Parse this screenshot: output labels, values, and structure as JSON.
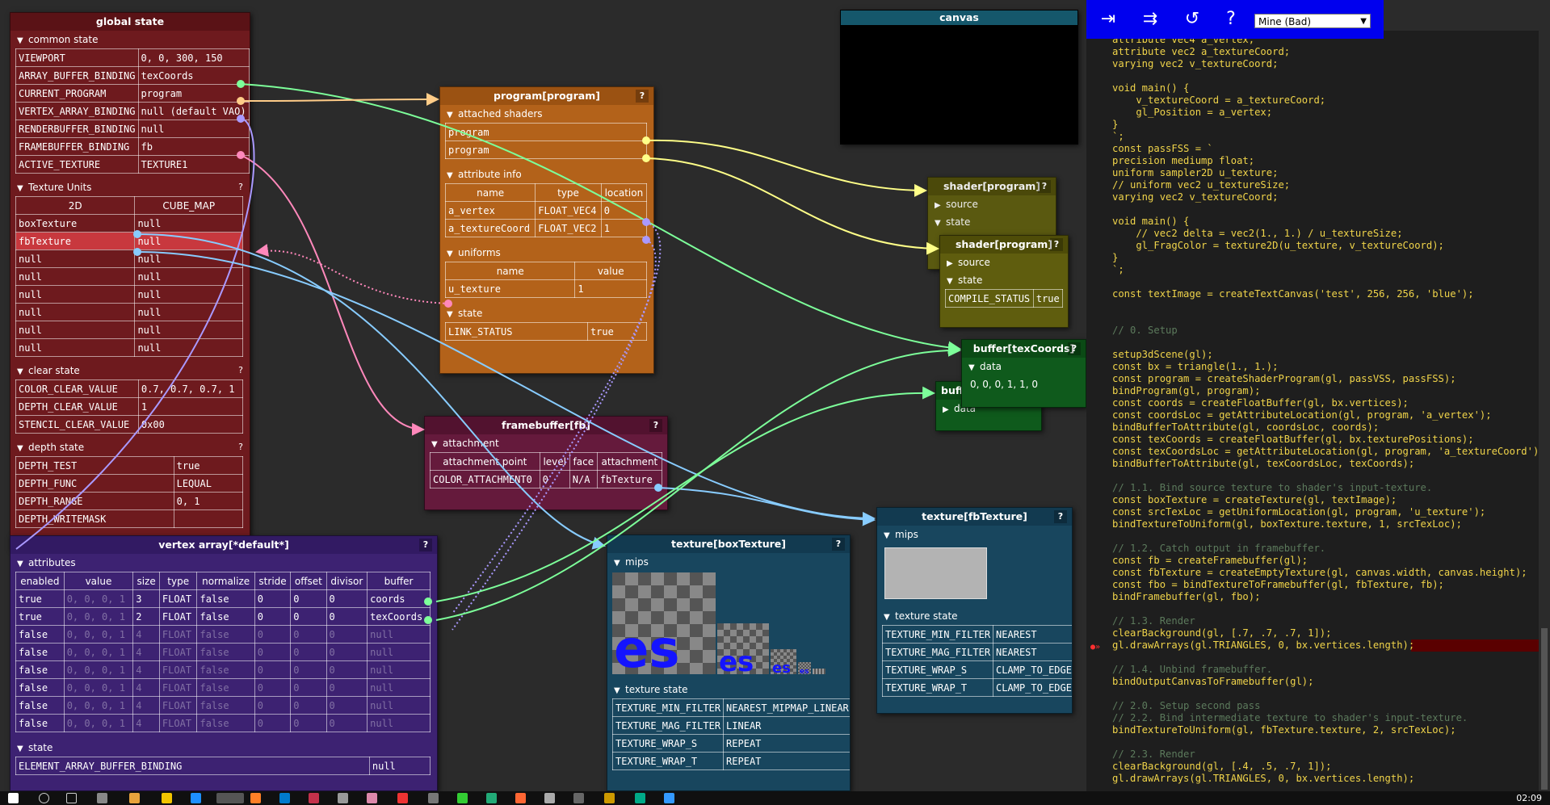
{
  "toolbar": {
    "buttons": [
      "⇥",
      "⇉",
      "↺",
      "?"
    ],
    "example_select": "Mine (Bad)"
  },
  "global_state": {
    "title": "global state",
    "common_state_label": "common state",
    "common_rows": [
      [
        "VIEWPORT",
        "0, 0, 300, 150"
      ],
      [
        "ARRAY_BUFFER_BINDING",
        "texCoords"
      ],
      [
        "CURRENT_PROGRAM",
        "program"
      ],
      [
        "VERTEX_ARRAY_BINDING",
        "null (default VAO)"
      ],
      [
        "RENDERBUFFER_BINDING",
        "null"
      ],
      [
        "FRAMEBUFFER_BINDING",
        "fb"
      ],
      [
        "ACTIVE_TEXTURE",
        "TEXTURE1"
      ]
    ],
    "texture_units_label": "Texture Units",
    "texture_units_header": [
      "2D",
      "CUBE_MAP"
    ],
    "texture_units_rows": [
      [
        "boxTexture",
        "null"
      ],
      [
        "fbTexture",
        "null"
      ],
      [
        "null",
        "null"
      ],
      [
        "null",
        "null"
      ],
      [
        "null",
        "null"
      ],
      [
        "null",
        "null"
      ],
      [
        "null",
        "null"
      ],
      [
        "null",
        "null"
      ]
    ],
    "clear_state_label": "clear state",
    "clear_rows": [
      [
        "COLOR_CLEAR_VALUE",
        "0.7, 0.7, 0.7, 1"
      ],
      [
        "DEPTH_CLEAR_VALUE",
        "1"
      ],
      [
        "STENCIL_CLEAR_VALUE",
        "0x00"
      ]
    ],
    "depth_state_label": "depth state",
    "depth_rows": [
      [
        "DEPTH_TEST",
        "true"
      ],
      [
        "DEPTH_FUNC",
        "LEQUAL"
      ],
      [
        "DEPTH_RANGE",
        "0, 1"
      ],
      [
        "DEPTH_WRITEMASK",
        ""
      ]
    ],
    "q": "?"
  },
  "program": {
    "title": "program[program]",
    "attached_shaders_label": "attached shaders",
    "shaders": [
      "program",
      "program"
    ],
    "attribute_info_label": "attribute info",
    "attr_header": [
      "name",
      "type",
      "location"
    ],
    "attr_rows": [
      [
        "a_vertex",
        "FLOAT_VEC4",
        "0"
      ],
      [
        "a_textureCoord",
        "FLOAT_VEC2",
        "1"
      ]
    ],
    "uniforms_label": "uniforms",
    "uni_header": [
      "name",
      "value"
    ],
    "uni_rows": [
      [
        "u_texture",
        "1"
      ]
    ],
    "state_label": "state",
    "state_rows": [
      [
        "LINK_STATUS",
        "true"
      ]
    ],
    "q": "?"
  },
  "framebuffer": {
    "title": "framebuffer[fb]",
    "attachment_label": "attachment",
    "header": [
      "attachment point",
      "level",
      "face",
      "attachment"
    ],
    "rows": [
      [
        "COLOR_ATTACHMENT0",
        "0",
        "N/A",
        "fbTexture"
      ]
    ],
    "q": "?"
  },
  "vertex_array": {
    "title": "vertex array[*default*]",
    "attributes_label": "attributes",
    "header": [
      "enabled",
      "value",
      "size",
      "type",
      "normalize",
      "stride",
      "offset",
      "divisor",
      "buffer"
    ],
    "rows": [
      [
        "true",
        "0, 0, 0, 1",
        "3",
        "FLOAT",
        "false",
        "0",
        "0",
        "0",
        "coords"
      ],
      [
        "true",
        "0, 0, 0, 1",
        "2",
        "FLOAT",
        "false",
        "0",
        "0",
        "0",
        "texCoords"
      ],
      [
        "false",
        "0, 0, 0, 1",
        "4",
        "FLOAT",
        "false",
        "0",
        "0",
        "0",
        "null"
      ],
      [
        "false",
        "0, 0, 0, 1",
        "4",
        "FLOAT",
        "false",
        "0",
        "0",
        "0",
        "null"
      ],
      [
        "false",
        "0, 0, 0, 1",
        "4",
        "FLOAT",
        "false",
        "0",
        "0",
        "0",
        "null"
      ],
      [
        "false",
        "0, 0, 0, 1",
        "4",
        "FLOAT",
        "false",
        "0",
        "0",
        "0",
        "null"
      ],
      [
        "false",
        "0, 0, 0, 1",
        "4",
        "FLOAT",
        "false",
        "0",
        "0",
        "0",
        "null"
      ],
      [
        "false",
        "0, 0, 0, 1",
        "4",
        "FLOAT",
        "false",
        "0",
        "0",
        "0",
        "null"
      ]
    ],
    "state_label": "state",
    "state_rows": [
      [
        "ELEMENT_ARRAY_BUFFER_BINDING",
        "null"
      ]
    ],
    "q": "?"
  },
  "tex_box": {
    "title": "texture[boxTexture]",
    "mips_label": "mips",
    "mip_text": "es",
    "texture_state_label": "texture state",
    "rows": [
      [
        "TEXTURE_MIN_FILTER",
        "NEAREST_MIPMAP_LINEAR"
      ],
      [
        "TEXTURE_MAG_FILTER",
        "LINEAR"
      ],
      [
        "TEXTURE_WRAP_S",
        "REPEAT"
      ],
      [
        "TEXTURE_WRAP_T",
        "REPEAT"
      ]
    ],
    "q": "?"
  },
  "tex_fb": {
    "title": "texture[fbTexture]",
    "mips_label": "mips",
    "texture_state_label": "texture state",
    "rows": [
      [
        "TEXTURE_MIN_FILTER",
        "NEAREST"
      ],
      [
        "TEXTURE_MAG_FILTER",
        "NEAREST"
      ],
      [
        "TEXTURE_WRAP_S",
        "CLAMP_TO_EDGE"
      ],
      [
        "TEXTURE_WRAP_T",
        "CLAMP_TO_EDGE"
      ]
    ],
    "q": "?"
  },
  "canvas": {
    "title": "canvas"
  },
  "shader1": {
    "title": "shader[program]",
    "source_label": "source",
    "state_label": "state",
    "q": "?"
  },
  "shader2": {
    "title": "shader[program]",
    "source_label": "source",
    "state_label": "state",
    "rows": [
      [
        "COMPILE_STATUS",
        "true"
      ]
    ],
    "q": "?"
  },
  "buffer1": {
    "title": "buffer[texCoords]",
    "data_label": "data",
    "data_value": "0, 0, 0, 1, 1, 0",
    "q": "?"
  },
  "buffer2": {
    "title": "buffer[coords]",
    "data_label": "data",
    "q": "?"
  },
  "code": {
    "lines": [
      {
        "t": "attribute vec4 a_vertex;",
        "c": ""
      },
      {
        "t": "attribute vec2 a_textureCoord;",
        "c": ""
      },
      {
        "t": "varying vec2 v_textureCoord;",
        "c": ""
      },
      {
        "t": "",
        "c": ""
      },
      {
        "t": "void main() {",
        "c": ""
      },
      {
        "t": "    v_textureCoord = a_textureCoord;",
        "c": ""
      },
      {
        "t": "    gl_Position = a_vertex;",
        "c": ""
      },
      {
        "t": "}",
        "c": ""
      },
      {
        "t": "`;",
        "c": ""
      },
      {
        "t": "const passFSS = `",
        "c": ""
      },
      {
        "t": "precision mediump float;",
        "c": ""
      },
      {
        "t": "uniform sampler2D u_texture;",
        "c": ""
      },
      {
        "t": "// uniform vec2 u_textureSize;",
        "c": ""
      },
      {
        "t": "varying vec2 v_textureCoord;",
        "c": ""
      },
      {
        "t": "",
        "c": ""
      },
      {
        "t": "void main() {",
        "c": ""
      },
      {
        "t": "    // vec2 delta = vec2(1., 1.) / u_textureSize;",
        "c": ""
      },
      {
        "t": "    gl_FragColor = texture2D(u_texture, v_textureCoord);",
        "c": ""
      },
      {
        "t": "}",
        "c": ""
      },
      {
        "t": "`;",
        "c": ""
      },
      {
        "t": "",
        "c": ""
      },
      {
        "t": "const textImage = createTextCanvas('test', 256, 256, 'blue');",
        "c": ""
      },
      {
        "t": "",
        "c": ""
      },
      {
        "t": "",
        "c": ""
      },
      {
        "t": "// 0. Setup",
        "c": "cm"
      },
      {
        "t": "",
        "c": ""
      },
      {
        "t": "setup3dScene(gl);",
        "c": ""
      },
      {
        "t": "const bx = triangle(1., 1.);",
        "c": ""
      },
      {
        "t": "const program = createShaderProgram(gl, passVSS, passFSS);",
        "c": ""
      },
      {
        "t": "bindProgram(gl, program);",
        "c": ""
      },
      {
        "t": "const coords = createFloatBuffer(gl, bx.vertices);",
        "c": ""
      },
      {
        "t": "const coordsLoc = getAttributeLocation(gl, program, 'a_vertex');",
        "c": ""
      },
      {
        "t": "bindBufferToAttribute(gl, coordsLoc, coords);",
        "c": ""
      },
      {
        "t": "const texCoords = createFloatBuffer(gl, bx.texturePositions);",
        "c": ""
      },
      {
        "t": "const texCoordsLoc = getAttributeLocation(gl, program, 'a_textureCoord');",
        "c": ""
      },
      {
        "t": "bindBufferToAttribute(gl, texCoordsLoc, texCoords);",
        "c": ""
      },
      {
        "t": "",
        "c": ""
      },
      {
        "t": "// 1.1. Bind source texture to shader's input-texture.",
        "c": "cm"
      },
      {
        "t": "const boxTexture = createTexture(gl, textImage);",
        "c": ""
      },
      {
        "t": "const srcTexLoc = getUniformLocation(gl, program, 'u_texture');",
        "c": ""
      },
      {
        "t": "bindTextureToUniform(gl, boxTexture.texture, 1, srcTexLoc);",
        "c": ""
      },
      {
        "t": "",
        "c": ""
      },
      {
        "t": "// 1.2. Catch output in framebuffer.",
        "c": "cm"
      },
      {
        "t": "const fb = createFramebuffer(gl);",
        "c": ""
      },
      {
        "t": "const fbTexture = createEmptyTexture(gl, canvas.width, canvas.height);",
        "c": ""
      },
      {
        "t": "const fbo = bindTextureToFramebuffer(gl, fbTexture, fb);",
        "c": ""
      },
      {
        "t": "bindFramebuffer(gl, fbo);",
        "c": ""
      },
      {
        "t": "",
        "c": ""
      },
      {
        "t": "// 1.3. Render",
        "c": "cm"
      },
      {
        "t": "clearBackground(gl, [.7, .7, .7, 1]);",
        "c": ""
      },
      {
        "t": "gl.drawArrays(gl.TRIANGLES, 0, bx.vertices.length);",
        "c": "err"
      },
      {
        "t": "",
        "c": ""
      },
      {
        "t": "// 1.4. Unbind framebuffer.",
        "c": "cm"
      },
      {
        "t": "bindOutputCanvasToFramebuffer(gl);",
        "c": ""
      },
      {
        "t": "",
        "c": ""
      },
      {
        "t": "// 2.0. Setup second pass",
        "c": "cm"
      },
      {
        "t": "// 2.2. Bind intermediate texture to shader's input-texture.",
        "c": "cm"
      },
      {
        "t": "bindTextureToUniform(gl, fbTexture.texture, 2, srcTexLoc);",
        "c": ""
      },
      {
        "t": "",
        "c": ""
      },
      {
        "t": "// 2.3. Render",
        "c": "cm"
      },
      {
        "t": "clearBackground(gl, [.4, .5, .7, 1]);",
        "c": ""
      },
      {
        "t": "gl.drawArrays(gl.TRIANGLES, 0, bx.vertices.length);",
        "c": ""
      }
    ]
  },
  "taskbar": {
    "clock": "02:09"
  },
  "colors": {
    "link_green": "#7dff9a",
    "link_orange": "#ffcc88",
    "link_pink": "#ff88bb",
    "link_blue": "#88ccff",
    "link_yellow": "#ffff88",
    "link_purple": "#aa99ff"
  }
}
